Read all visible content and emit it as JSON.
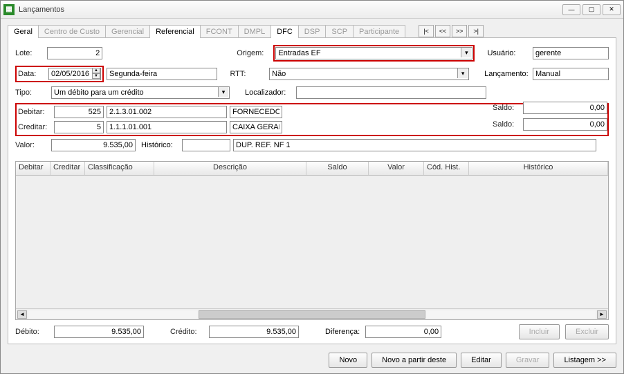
{
  "window": {
    "title": "Lançamentos"
  },
  "tabs": [
    "Geral",
    "Centro de Custo",
    "Gerencial",
    "Referencial",
    "FCONT",
    "DMPL",
    "DFC",
    "DSP",
    "SCP",
    "Participante"
  ],
  "activeTabs": [
    "Geral",
    "Referencial",
    "DFC"
  ],
  "form": {
    "lote_label": "Lote:",
    "lote_value": "2",
    "data_label": "Data:",
    "data_value": "02/05/2016",
    "data_day": "Segunda-feira",
    "tipo_label": "Tipo:",
    "tipo_value": "Um débito para um crédito",
    "origem_label": "Origem:",
    "origem_value": "Entradas EF",
    "rtt_label": "RTT:",
    "rtt_value": "Não",
    "localizador_label": "Localizador:",
    "localizador_value": "",
    "usuario_label": "Usuário:",
    "usuario_value": "gerente",
    "lancamento_label": "Lançamento:",
    "lancamento_value": "Manual",
    "debitar_label": "Debitar:",
    "debitar_code": "525",
    "debitar_account": "2.1.3.01.002",
    "debitar_name": "FORNECEDOR",
    "creditar_label": "Creditar:",
    "creditar_code": "5",
    "creditar_account": "1.1.1.01.001",
    "creditar_name": "CAIXA GERAL",
    "saldo_label": "Saldo:",
    "saldo_deb": "0,00",
    "saldo_cred": "0,00",
    "valor_label": "Valor:",
    "valor_value": "9.535,00",
    "historico_label": "Histórico:",
    "historico_value": "DUP. REF. NF 1"
  },
  "grid": {
    "headers": [
      "Debitar",
      "Creditar",
      "Classificação",
      "Descrição",
      "Saldo",
      "Valor",
      "Cód. Hist.",
      "Histórico"
    ]
  },
  "sums": {
    "debito_label": "Débito:",
    "debito_value": "9.535,00",
    "credito_label": "Crédito:",
    "credito_value": "9.535,00",
    "diferenca_label": "Diferença:",
    "diferenca_value": "0,00",
    "incluir": "Incluir",
    "excluir": "Excluir"
  },
  "footer": {
    "novo": "Novo",
    "novo_apartir": "Novo a partir deste",
    "editar": "Editar",
    "gravar": "Gravar",
    "listagem": "Listagem >>"
  }
}
